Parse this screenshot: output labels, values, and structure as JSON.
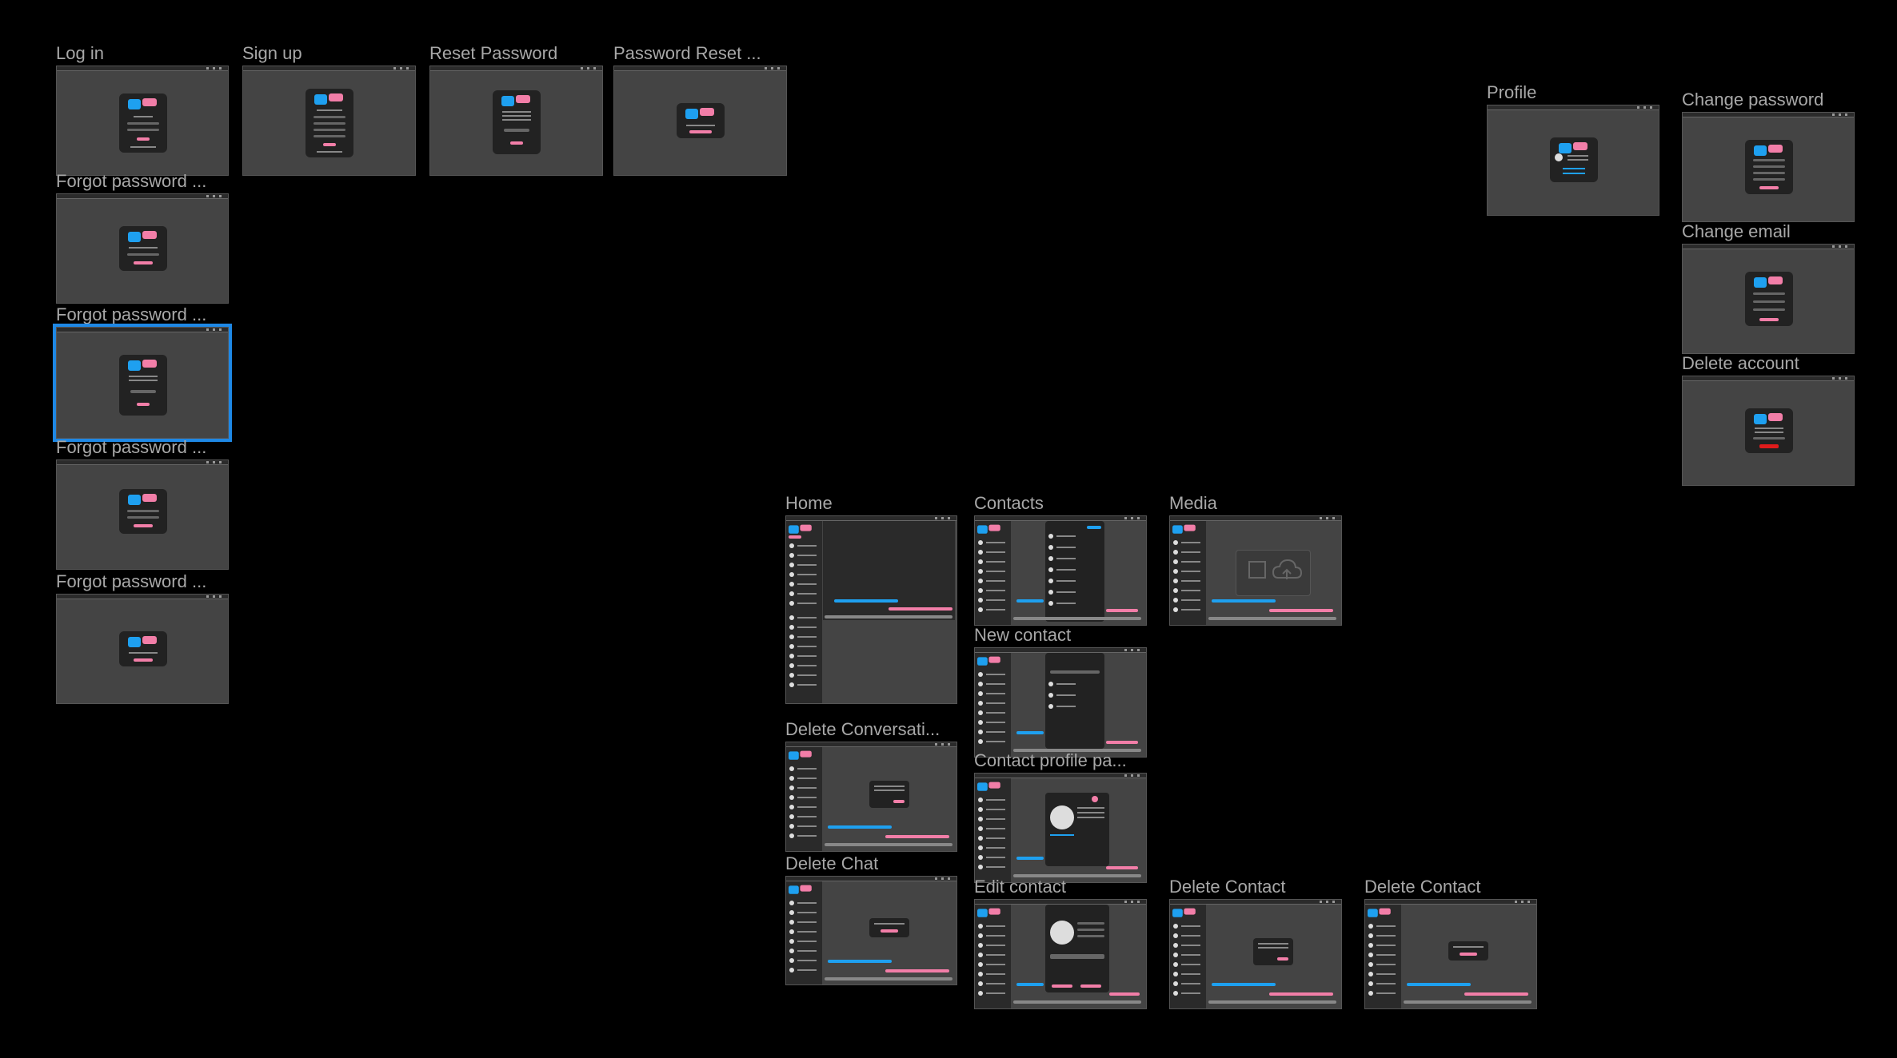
{
  "canvas": {
    "background": "#000000",
    "selection_color": "#1e88e5"
  },
  "frames": {
    "login": {
      "title": "Log in"
    },
    "signup": {
      "title": "Sign up"
    },
    "reset_password": {
      "title": "Reset Password"
    },
    "password_reset": {
      "title": "Password Reset ..."
    },
    "forgot1": {
      "title": "Forgot password ..."
    },
    "forgot2": {
      "title": "Forgot password ...",
      "selected": true
    },
    "forgot3": {
      "title": "Forgot password ..."
    },
    "forgot4": {
      "title": "Forgot password ..."
    },
    "profile": {
      "title": "Profile"
    },
    "change_password": {
      "title": "Change password"
    },
    "change_email": {
      "title": "Change email"
    },
    "delete_account": {
      "title": "Delete account"
    },
    "home": {
      "title": "Home"
    },
    "contacts": {
      "title": "Contacts"
    },
    "media": {
      "title": "Media"
    },
    "new_contact": {
      "title": "New contact"
    },
    "delete_conversation": {
      "title": "Delete Conversati..."
    },
    "contact_profile": {
      "title": "Contact profile pa..."
    },
    "delete_chat": {
      "title": "Delete Chat"
    },
    "edit_contact": {
      "title": "Edit contact"
    },
    "delete_contact_1": {
      "title": "Delete Contact"
    },
    "delete_contact_2": {
      "title": "Delete Contact"
    }
  },
  "colors": {
    "accent_blue": "#1ea0f0",
    "accent_pink": "#f27ea8",
    "danger_red": "#e01b1b",
    "frame_bg": "#444444"
  }
}
